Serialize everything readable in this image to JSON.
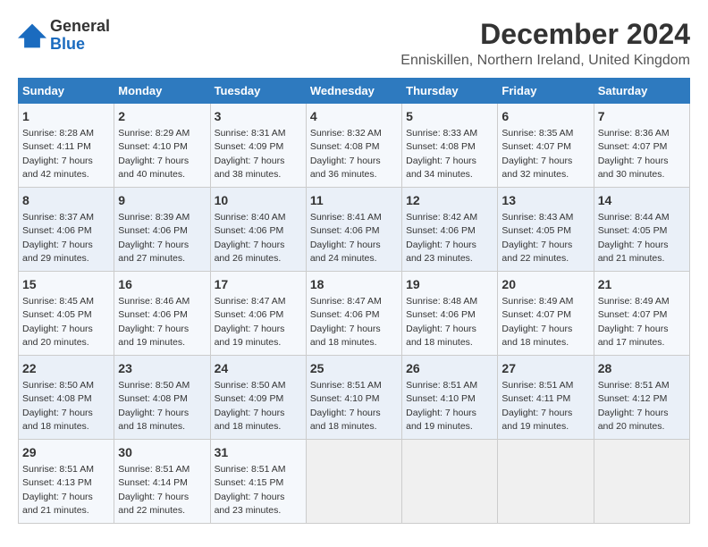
{
  "logo": {
    "line1": "General",
    "line2": "Blue"
  },
  "title": "December 2024",
  "subtitle": "Enniskillen, Northern Ireland, United Kingdom",
  "weekdays": [
    "Sunday",
    "Monday",
    "Tuesday",
    "Wednesday",
    "Thursday",
    "Friday",
    "Saturday"
  ],
  "weeks": [
    [
      {
        "day": 1,
        "sunrise": "8:28 AM",
        "sunset": "4:11 PM",
        "daylight": "7 hours and 42 minutes."
      },
      {
        "day": 2,
        "sunrise": "8:29 AM",
        "sunset": "4:10 PM",
        "daylight": "7 hours and 40 minutes."
      },
      {
        "day": 3,
        "sunrise": "8:31 AM",
        "sunset": "4:09 PM",
        "daylight": "7 hours and 38 minutes."
      },
      {
        "day": 4,
        "sunrise": "8:32 AM",
        "sunset": "4:08 PM",
        "daylight": "7 hours and 36 minutes."
      },
      {
        "day": 5,
        "sunrise": "8:33 AM",
        "sunset": "4:08 PM",
        "daylight": "7 hours and 34 minutes."
      },
      {
        "day": 6,
        "sunrise": "8:35 AM",
        "sunset": "4:07 PM",
        "daylight": "7 hours and 32 minutes."
      },
      {
        "day": 7,
        "sunrise": "8:36 AM",
        "sunset": "4:07 PM",
        "daylight": "7 hours and 30 minutes."
      }
    ],
    [
      {
        "day": 8,
        "sunrise": "8:37 AM",
        "sunset": "4:06 PM",
        "daylight": "7 hours and 29 minutes."
      },
      {
        "day": 9,
        "sunrise": "8:39 AM",
        "sunset": "4:06 PM",
        "daylight": "7 hours and 27 minutes."
      },
      {
        "day": 10,
        "sunrise": "8:40 AM",
        "sunset": "4:06 PM",
        "daylight": "7 hours and 26 minutes."
      },
      {
        "day": 11,
        "sunrise": "8:41 AM",
        "sunset": "4:06 PM",
        "daylight": "7 hours and 24 minutes."
      },
      {
        "day": 12,
        "sunrise": "8:42 AM",
        "sunset": "4:06 PM",
        "daylight": "7 hours and 23 minutes."
      },
      {
        "day": 13,
        "sunrise": "8:43 AM",
        "sunset": "4:05 PM",
        "daylight": "7 hours and 22 minutes."
      },
      {
        "day": 14,
        "sunrise": "8:44 AM",
        "sunset": "4:05 PM",
        "daylight": "7 hours and 21 minutes."
      }
    ],
    [
      {
        "day": 15,
        "sunrise": "8:45 AM",
        "sunset": "4:05 PM",
        "daylight": "7 hours and 20 minutes."
      },
      {
        "day": 16,
        "sunrise": "8:46 AM",
        "sunset": "4:06 PM",
        "daylight": "7 hours and 19 minutes."
      },
      {
        "day": 17,
        "sunrise": "8:47 AM",
        "sunset": "4:06 PM",
        "daylight": "7 hours and 19 minutes."
      },
      {
        "day": 18,
        "sunrise": "8:47 AM",
        "sunset": "4:06 PM",
        "daylight": "7 hours and 18 minutes."
      },
      {
        "day": 19,
        "sunrise": "8:48 AM",
        "sunset": "4:06 PM",
        "daylight": "7 hours and 18 minutes."
      },
      {
        "day": 20,
        "sunrise": "8:49 AM",
        "sunset": "4:07 PM",
        "daylight": "7 hours and 18 minutes."
      },
      {
        "day": 21,
        "sunrise": "8:49 AM",
        "sunset": "4:07 PM",
        "daylight": "7 hours and 17 minutes."
      }
    ],
    [
      {
        "day": 22,
        "sunrise": "8:50 AM",
        "sunset": "4:08 PM",
        "daylight": "7 hours and 18 minutes."
      },
      {
        "day": 23,
        "sunrise": "8:50 AM",
        "sunset": "4:08 PM",
        "daylight": "7 hours and 18 minutes."
      },
      {
        "day": 24,
        "sunrise": "8:50 AM",
        "sunset": "4:09 PM",
        "daylight": "7 hours and 18 minutes."
      },
      {
        "day": 25,
        "sunrise": "8:51 AM",
        "sunset": "4:10 PM",
        "daylight": "7 hours and 18 minutes."
      },
      {
        "day": 26,
        "sunrise": "8:51 AM",
        "sunset": "4:10 PM",
        "daylight": "7 hours and 19 minutes."
      },
      {
        "day": 27,
        "sunrise": "8:51 AM",
        "sunset": "4:11 PM",
        "daylight": "7 hours and 19 minutes."
      },
      {
        "day": 28,
        "sunrise": "8:51 AM",
        "sunset": "4:12 PM",
        "daylight": "7 hours and 20 minutes."
      }
    ],
    [
      {
        "day": 29,
        "sunrise": "8:51 AM",
        "sunset": "4:13 PM",
        "daylight": "7 hours and 21 minutes."
      },
      {
        "day": 30,
        "sunrise": "8:51 AM",
        "sunset": "4:14 PM",
        "daylight": "7 hours and 22 minutes."
      },
      {
        "day": 31,
        "sunrise": "8:51 AM",
        "sunset": "4:15 PM",
        "daylight": "7 hours and 23 minutes."
      },
      null,
      null,
      null,
      null
    ]
  ]
}
